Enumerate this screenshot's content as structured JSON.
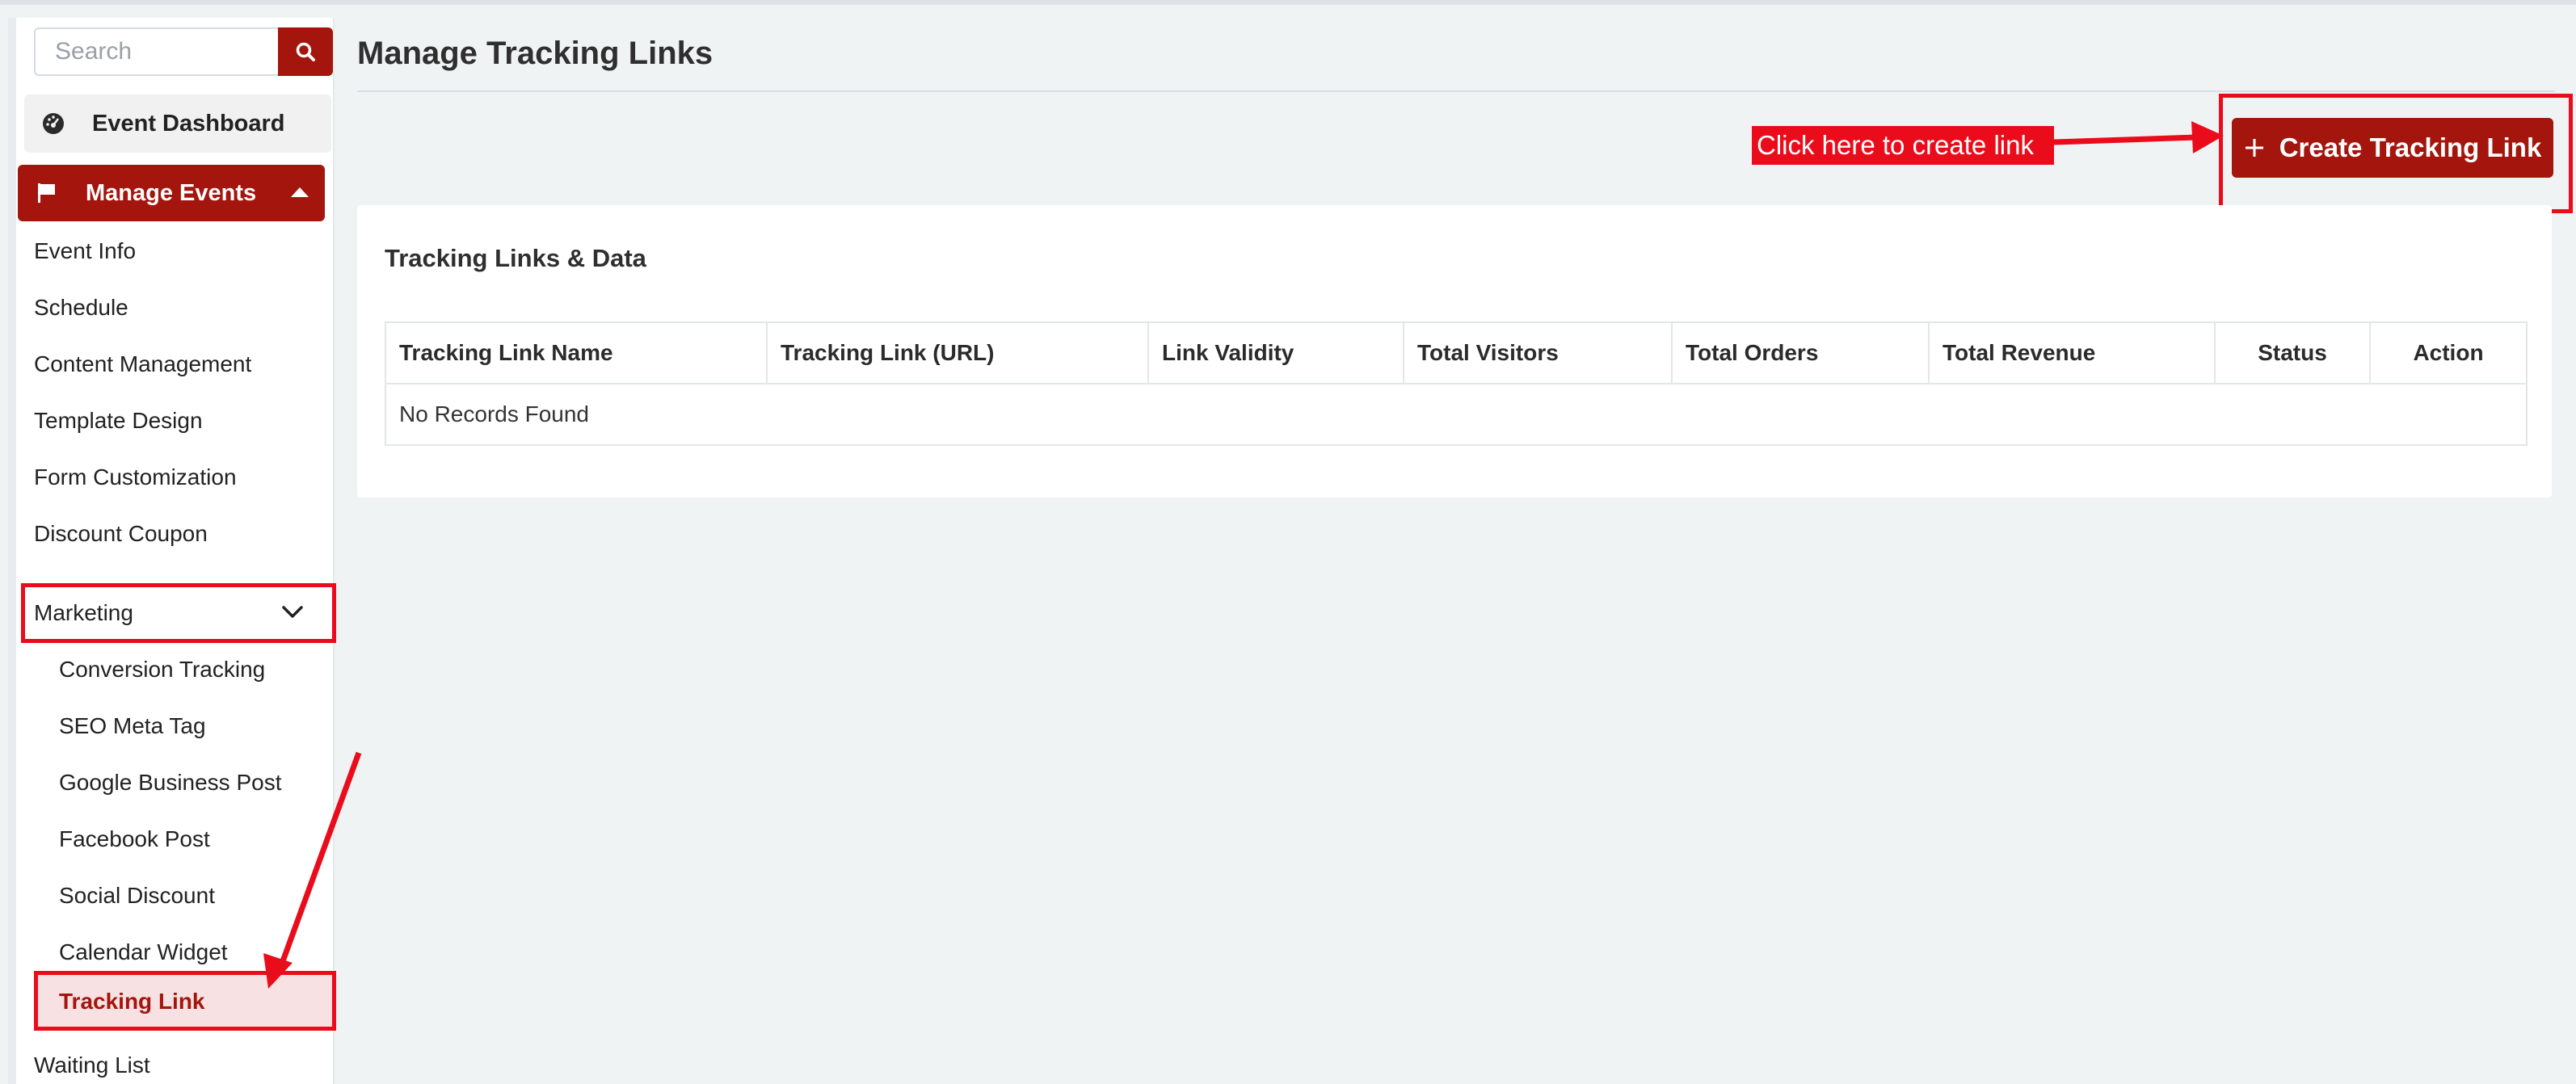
{
  "search": {
    "placeholder": "Search"
  },
  "sidebar": {
    "dashboard_label": "Event Dashboard",
    "manage_events_label": "Manage Events",
    "items": [
      "Event Info",
      "Schedule",
      "Content Management",
      "Template Design",
      "Form Customization",
      "Discount Coupon",
      "Marketing"
    ],
    "marketing_children": [
      "Conversion Tracking",
      "SEO Meta Tag",
      "Google Business Post",
      "Facebook Post",
      "Social Discount",
      "Calendar Widget",
      "Tracking Link"
    ],
    "after_marketing": [
      "Waiting List"
    ]
  },
  "main": {
    "title": "Manage Tracking Links",
    "create_button_label": "Create Tracking Link",
    "callout_text": "Click here to create link",
    "card_title": "Tracking Links & Data",
    "table": {
      "columns": [
        "Tracking Link Name",
        "Tracking Link (URL)",
        "Link Validity",
        "Total Visitors",
        "Total Orders",
        "Total Revenue",
        "Status",
        "Action"
      ],
      "empty_text": "No Records Found"
    }
  },
  "colors": {
    "brand": "#a4150d",
    "annotation": "#ea0c1b",
    "active_bg": "#f7e1e2"
  },
  "icons": [
    "search-icon",
    "dashboard-icon",
    "flag-icon",
    "caret-up-icon",
    "chevron-down-icon",
    "plus-icon"
  ]
}
